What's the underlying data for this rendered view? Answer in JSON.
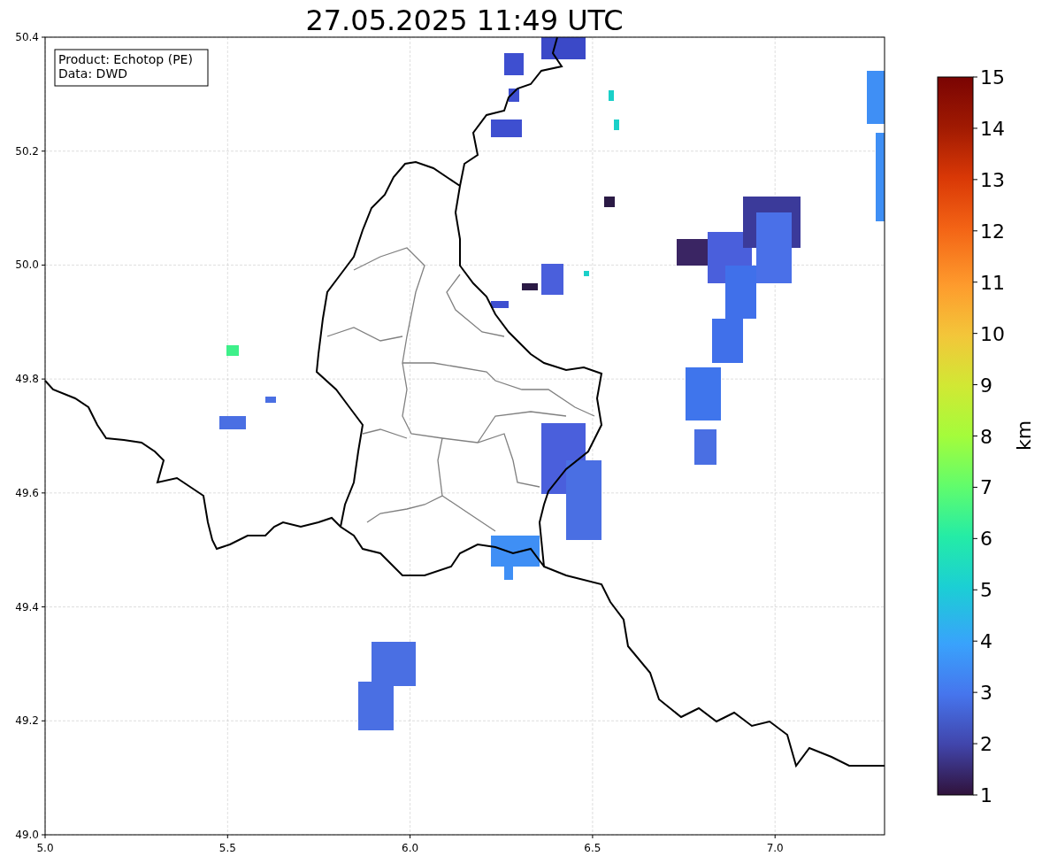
{
  "title": "27.05.2025 11:49 UTC",
  "legend": [
    "Product: Echotop (PE)",
    "Data: DWD"
  ],
  "map": {
    "x_ticks": [
      "5.0",
      "5.5",
      "6.0",
      "6.5",
      "7.0"
    ],
    "y_ticks": [
      "50.4",
      "50.2",
      "50.0",
      "49.8",
      "49.6",
      "49.4",
      "49.2",
      "49.0"
    ]
  },
  "colorbar": {
    "label": "km",
    "ticks": [
      "15",
      "14",
      "13",
      "12",
      "11",
      "10",
      "9",
      "8",
      "7",
      "6",
      "5",
      "4",
      "3",
      "2",
      "1"
    ]
  }
}
